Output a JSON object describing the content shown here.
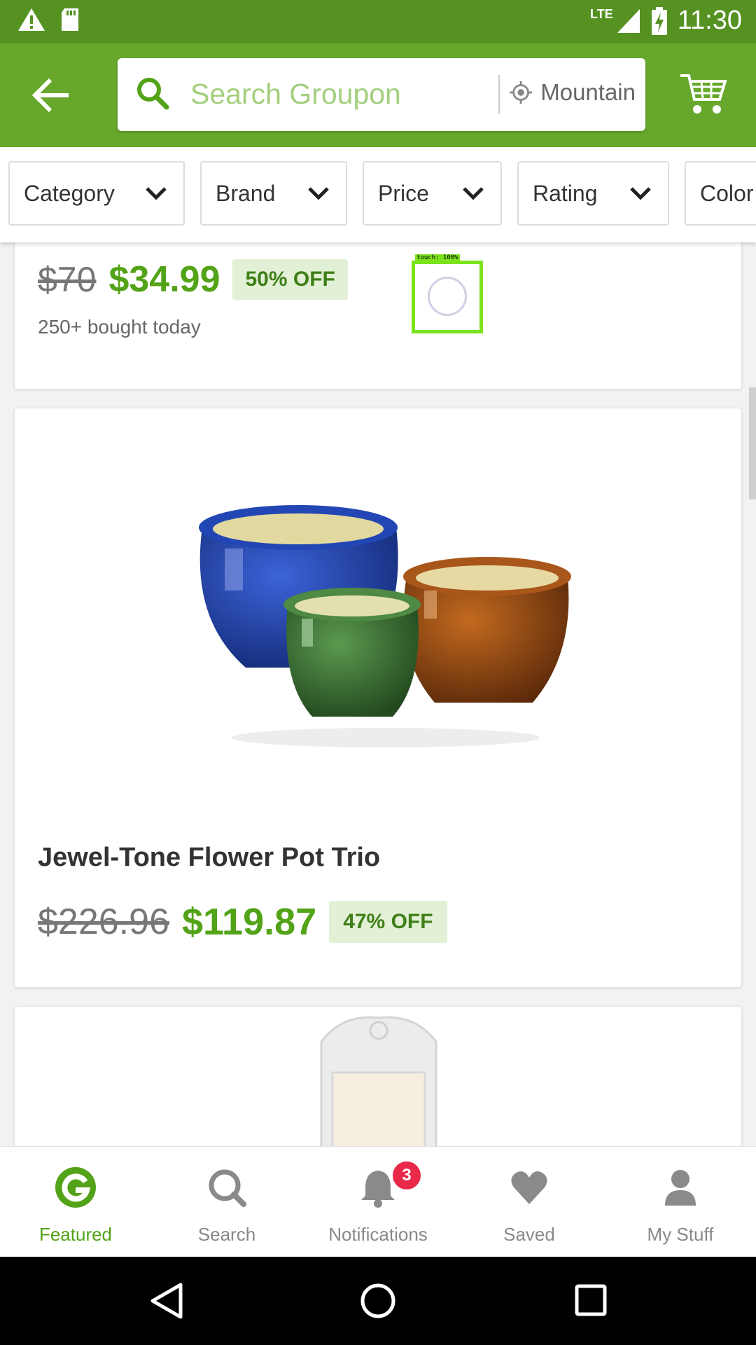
{
  "status_bar": {
    "network": "LTE",
    "time": "11:30"
  },
  "search": {
    "placeholder": "Search Groupon",
    "location": "Mountain"
  },
  "filters": [
    "Category",
    "Brand",
    "Price",
    "Rating",
    "Color"
  ],
  "deals": [
    {
      "old_price": "$70",
      "new_price": "$34.99",
      "discount": "50% OFF",
      "bought": "250+ bought today"
    },
    {
      "title": "Jewel-Tone Flower Pot Trio",
      "old_price": "$226.96",
      "new_price": "$119.87",
      "discount": "47% OFF"
    }
  ],
  "touch_overlay": {
    "label": "touch: 100%"
  },
  "bottom_nav": {
    "items": [
      {
        "label": "Featured",
        "icon": "groupon-g-icon",
        "active": true
      },
      {
        "label": "Search",
        "icon": "search-icon"
      },
      {
        "label": "Notifications",
        "icon": "bell-icon",
        "badge": "3"
      },
      {
        "label": "Saved",
        "icon": "heart-icon"
      },
      {
        "label": "My Stuff",
        "icon": "person-icon"
      }
    ]
  },
  "colors": {
    "brand_green": "#67a72c",
    "status_green": "#559222",
    "price_green": "#53a318",
    "badge_red": "#e8294a"
  }
}
